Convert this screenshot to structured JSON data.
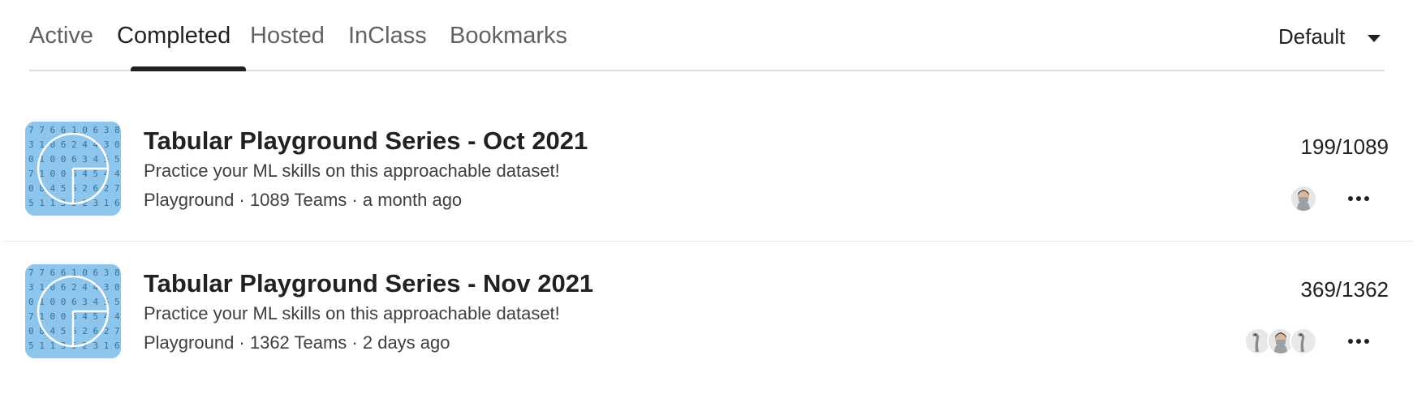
{
  "tabs": [
    {
      "label": "Active",
      "active": false
    },
    {
      "label": "Completed",
      "active": true
    },
    {
      "label": "Hosted",
      "active": false
    },
    {
      "label": "InClass",
      "active": false
    },
    {
      "label": "Bookmarks",
      "active": false
    }
  ],
  "sort": {
    "label": "Default",
    "icon": "caret-down-icon"
  },
  "competitions": [
    {
      "title": "Tabular Playground Series - Oct 2021",
      "description": "Practice your ML skills on this approachable dataset!",
      "meta": "Playground · 1089 Teams · a month ago",
      "rank": "199/1089",
      "team_avatars": [
        "masked-person-avatar"
      ],
      "thumbnail_digits": [
        "77661063 8",
        "31062443 0",
        "01006345 5",
        "71006454 4",
        "08455262 7",
        "51135231 6"
      ]
    },
    {
      "title": "Tabular Playground Series - Nov 2021",
      "description": "Practice your ML skills on this approachable dataset!",
      "meta": "Playground · 1362 Teams · 2 days ago",
      "rank": "369/1362",
      "team_avatars": [
        "ostrich-avatar",
        "masked-person-avatar",
        "ostrich-avatar"
      ],
      "thumbnail_digits": [
        "77661063 8",
        "31062443 0",
        "01006345 5",
        "71006454 4",
        "08455262 7",
        "51135231 6"
      ]
    }
  ],
  "colors": {
    "thumbnail_bg": "#8ec5ec",
    "active_tab_indicator": "#202124",
    "divider": "#dadce0"
  }
}
